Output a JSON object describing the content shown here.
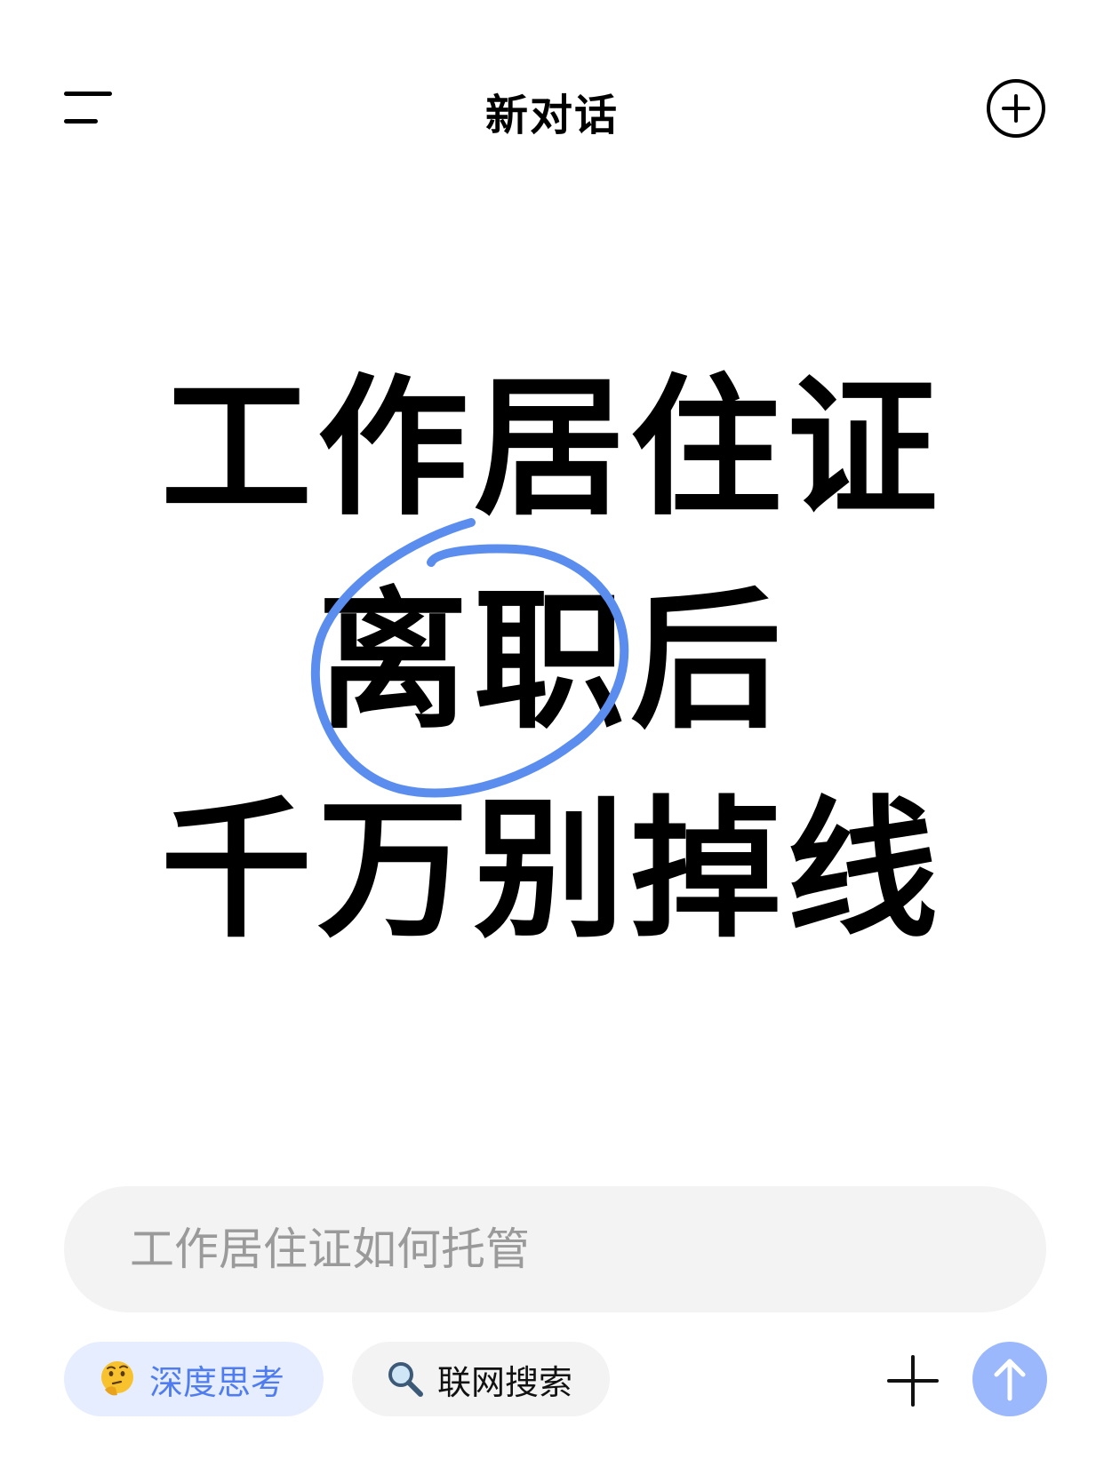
{
  "header": {
    "title": "新对话",
    "menu_icon": "menu-icon",
    "new_chat_icon": "plus-circle-icon"
  },
  "headline": {
    "line1": "工作居住证",
    "line2": "离职后",
    "line3": "千万别掉线",
    "circle_color": "#5b8def"
  },
  "input": {
    "placeholder": "工作居住证如何托管"
  },
  "toolbar": {
    "deep_think_label": "深度思考",
    "deep_think_icon": "thinking-face-icon",
    "web_search_label": "联网搜索",
    "web_search_icon": "magnifier-icon",
    "attach_icon": "plus-icon",
    "send_icon": "arrow-up-icon"
  },
  "colors": {
    "accent": "#4f7df0",
    "send_button": "#9ab8fb",
    "chip_active_bg": "#e6edff",
    "input_bg": "#f3f3f3"
  }
}
